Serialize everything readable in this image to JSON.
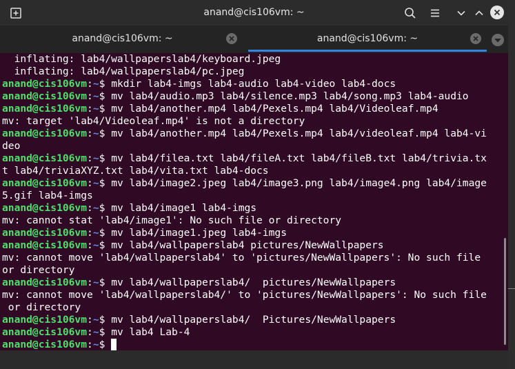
{
  "window": {
    "title": "anand@cis106vm: ~"
  },
  "tabs": [
    {
      "label": "anand@cis106vm: ~",
      "active": false
    },
    {
      "label": "anand@cis106vm: ~",
      "active": true
    }
  ],
  "icons": {
    "new_tab": "new-tab-icon",
    "search": "search-icon",
    "menu": "hamburger-menu-icon",
    "minimize": "chevron-down-icon",
    "maximize": "chevron-up-icon",
    "close": "close-icon",
    "tab_close": "tab-close-icon",
    "tab_overflow": "chevron-down-icon"
  },
  "colors": {
    "terminal_bg": "#300a24",
    "prompt_user": "#4ee06a",
    "prompt_path": "#5a8fe0",
    "accent": "#3584e4"
  },
  "terminal": {
    "lines": [
      {
        "type": "out",
        "text": "  inflating: lab4/wallpaperslab4/keyboard.jpeg"
      },
      {
        "type": "out",
        "text": "  inflating: lab4/wallpaperslab4/pc.jpeg"
      },
      {
        "type": "cmd",
        "user": "anand@cis106vm",
        "path": "~",
        "cmd": "mkdir lab4-imgs lab4-audio lab4-video lab4-docs"
      },
      {
        "type": "cmd",
        "user": "anand@cis106vm",
        "path": "~",
        "cmd": "mv lab4/audio.mp3 lab4/silence.mp3 lab4/song.mp3 lab4-audio"
      },
      {
        "type": "cmd",
        "user": "anand@cis106vm",
        "path": "~",
        "cmd": "mv lab4/another.mp4 lab4/Pexels.mp4 lab4/Videoleaf.mp4"
      },
      {
        "type": "out",
        "text": "mv: target 'lab4/Videoleaf.mp4' is not a directory"
      },
      {
        "type": "cmd",
        "user": "anand@cis106vm",
        "path": "~",
        "cmd": "mv lab4/another.mp4 lab4/Pexels.mp4 lab4/videoleaf.mp4 lab4-vi"
      },
      {
        "type": "out",
        "text": "deo"
      },
      {
        "type": "cmd",
        "user": "anand@cis106vm",
        "path": "~",
        "cmd": "mv lab4/filea.txt lab4/fileA.txt lab4/fileB.txt lab4/trivia.tx"
      },
      {
        "type": "out",
        "text": "t lab4/triviaXYZ.txt lab4/vita.txt lab4-docs"
      },
      {
        "type": "cmd",
        "user": "anand@cis106vm",
        "path": "~",
        "cmd": "mv lab4/image2.jpeg lab4/image3.png lab4/image4.png lab4/image"
      },
      {
        "type": "out",
        "text": "5.gif lab4-imgs"
      },
      {
        "type": "cmd",
        "user": "anand@cis106vm",
        "path": "~",
        "cmd": "mv lab4/image1 lab4-imgs"
      },
      {
        "type": "out",
        "text": "mv: cannot stat 'lab4/image1': No such file or directory"
      },
      {
        "type": "cmd",
        "user": "anand@cis106vm",
        "path": "~",
        "cmd": "mv lab4/image1.jpeg lab4-imgs"
      },
      {
        "type": "cmd",
        "user": "anand@cis106vm",
        "path": "~",
        "cmd": "mv lab4/wallpaperslab4 pictures/NewWallpapers"
      },
      {
        "type": "out",
        "text": "mv: cannot move 'lab4/wallpaperslab4' to 'pictures/NewWallpapers': No such file"
      },
      {
        "type": "out",
        "text": "or directory"
      },
      {
        "type": "cmd",
        "user": "anand@cis106vm",
        "path": "~",
        "cmd": "mv lab4/wallpaperslab4/  pictures/NewWallpapers"
      },
      {
        "type": "out",
        "text": "mv: cannot move 'lab4/wallpaperslab4/' to 'pictures/NewWallpapers': No such file"
      },
      {
        "type": "out",
        "text": " or directory"
      },
      {
        "type": "cmd",
        "user": "anand@cis106vm",
        "path": "~",
        "cmd": "mv lab4/wallpaperslab4/  Pictures/NewWallpapers"
      },
      {
        "type": "cmd",
        "user": "anand@cis106vm",
        "path": "~",
        "cmd": "mv lab4 Lab-4"
      },
      {
        "type": "prompt",
        "user": "anand@cis106vm",
        "path": "~",
        "cmd": ""
      }
    ]
  }
}
